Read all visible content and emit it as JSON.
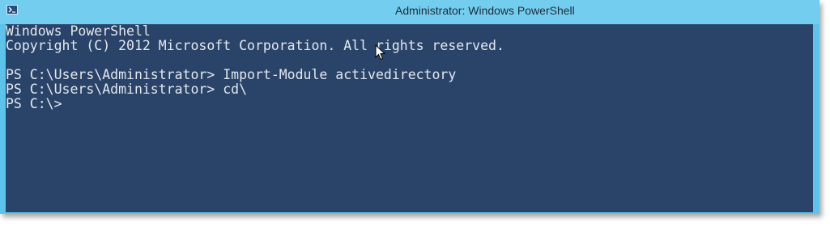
{
  "window": {
    "title": "Administrator: Windows PowerShell",
    "app_icon": "powershell-icon"
  },
  "console": {
    "lines": [
      "Windows PowerShell",
      "Copyright (C) 2012 Microsoft Corporation. All rights reserved.",
      "",
      "PS C:\\Users\\Administrator> Import-Module activedirectory",
      "PS C:\\Users\\Administrator> cd\\",
      "PS C:\\>"
    ]
  },
  "colors": {
    "titlebar": "#73cdef",
    "console_background": "#2a4469",
    "console_text": "#e4e8ee"
  }
}
